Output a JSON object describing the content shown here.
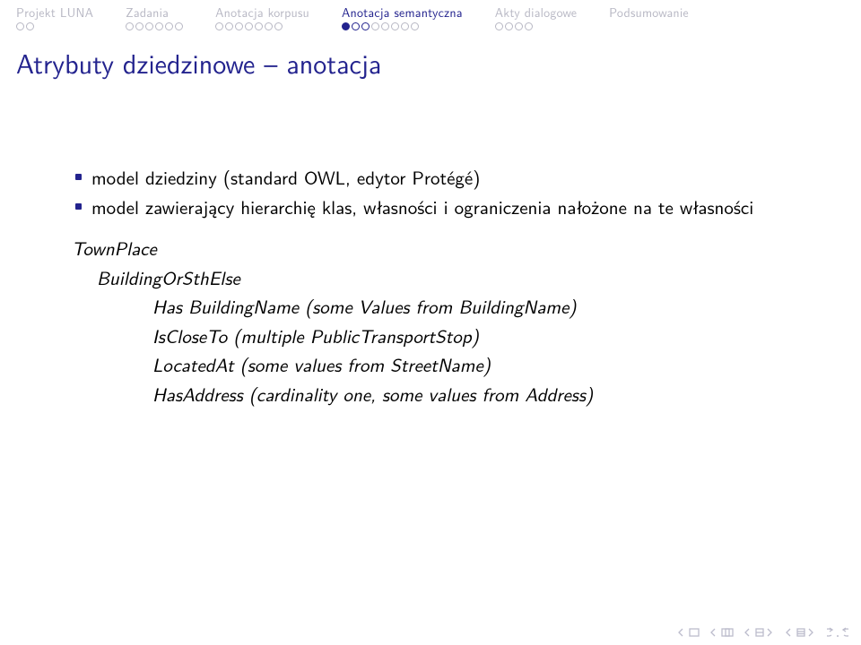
{
  "nav": {
    "sections": [
      {
        "label": "Projekt LUNA",
        "dots": 2,
        "current": false
      },
      {
        "label": "Zadania",
        "dots": 6,
        "current": false
      },
      {
        "label": "Anotacja korpusu",
        "dots": 7,
        "current": false
      },
      {
        "label": "Anotacja semantyczna",
        "dots": 8,
        "current": true,
        "activeIndex": 0
      },
      {
        "label": "Akty dialogowe",
        "dots": 4,
        "current": false
      },
      {
        "label": "Podsumowanie",
        "dots": 0,
        "current": false
      }
    ]
  },
  "title": "Atrybuty dziedzinowe – anotacja",
  "bullets": [
    "model dziedziny (standard OWL, edytor Protégé)",
    "model zawierający hierarchię klas, własności i ograniczenia nałożone na te własności"
  ],
  "defs": {
    "line1": "TownPlace",
    "line2": "BuildingOrSthElse",
    "line3": "Has BuildingName (some Values from BuildingName)",
    "line4": "IsCloseTo (multiple PublicTransportStop)",
    "line5": "LocatedAt (some values from StreetName)",
    "line6": "HasAddress (cardinality one, some values from Address)"
  }
}
